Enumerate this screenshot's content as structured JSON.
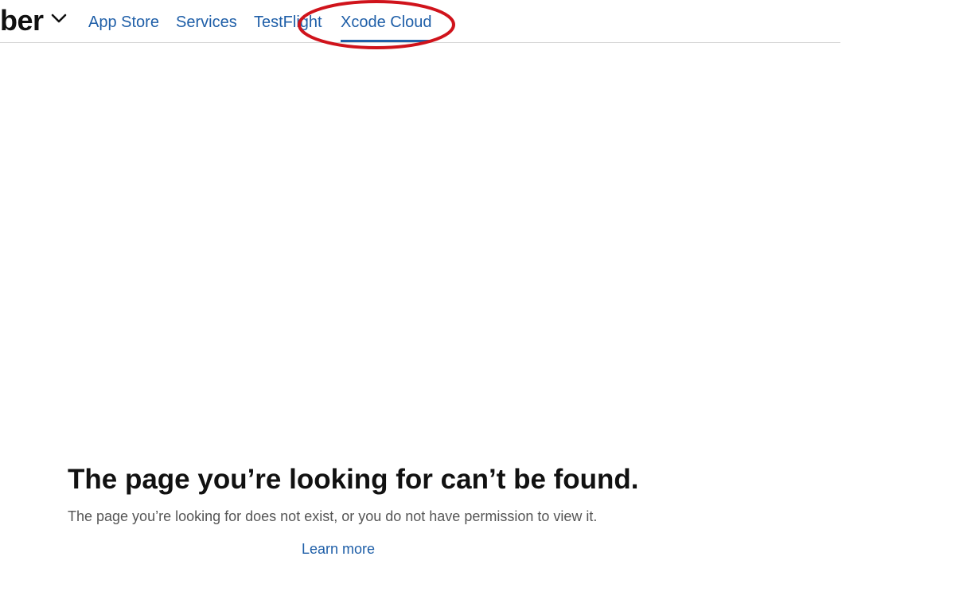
{
  "header": {
    "brand_label": "ber",
    "brand_menu_icon": "chevron-down-icon",
    "tabs": [
      {
        "label": "App Store"
      },
      {
        "label": "Services"
      },
      {
        "label": "TestFlight"
      },
      {
        "label": "Xcode Cloud",
        "selected": true
      }
    ]
  },
  "annotation": {
    "shape": "ellipse",
    "color": "#d0131b",
    "target": "Xcode Cloud"
  },
  "error": {
    "title": "The page you’re looking for can’t be found.",
    "message": "The page you’re looking for does not exist, or you do not have permission to view it.",
    "link_label": "Learn more"
  },
  "colors": {
    "link": "#1f5fa8",
    "text": "#111111",
    "secondary_text": "#555555",
    "divider": "#d6d6d6"
  }
}
